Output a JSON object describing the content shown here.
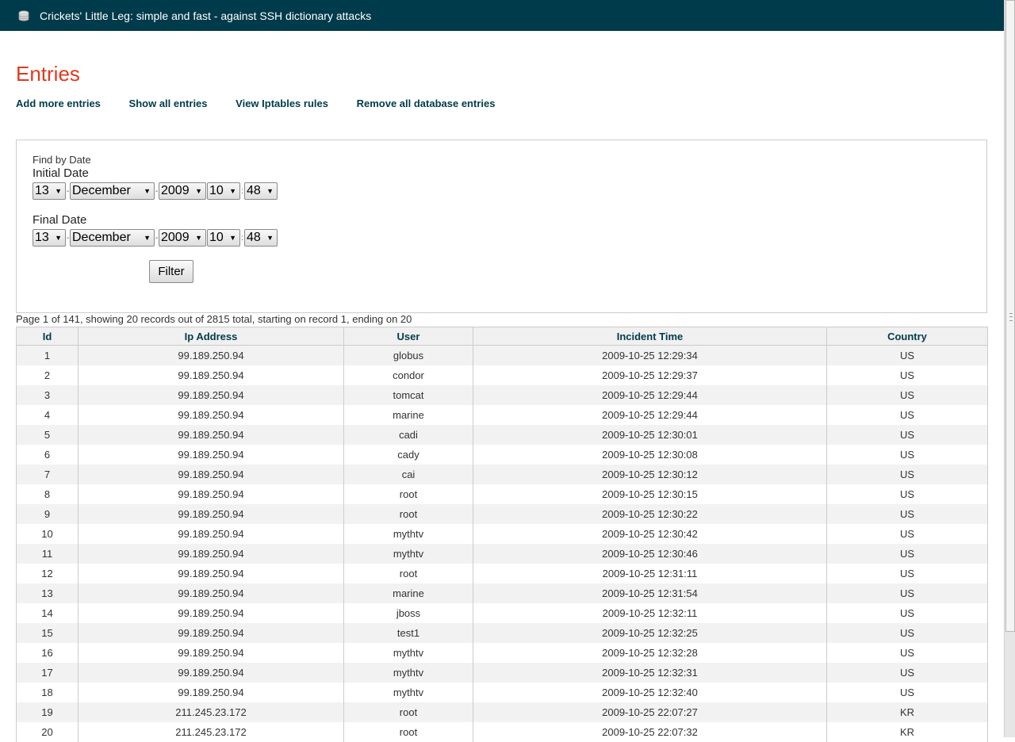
{
  "window": {
    "title": "Crickets' Little Leg: simple and fast - against SSH dictionary attacks"
  },
  "page": {
    "heading": "Entries"
  },
  "nav": [
    {
      "label": "Add more entries"
    },
    {
      "label": "Show all entries"
    },
    {
      "label": "View Iptables rules"
    },
    {
      "label": "Remove all database entries"
    }
  ],
  "filter": {
    "legend": "Find by Date",
    "initial": {
      "label": "Initial Date",
      "day": "13",
      "month": "December",
      "year": "2009",
      "hour": "10",
      "minute": "48"
    },
    "final": {
      "label": "Final Date",
      "day": "13",
      "month": "December",
      "year": "2009",
      "hour": "10",
      "minute": "48"
    },
    "date_sep": "-",
    "time_sep": ":",
    "button": "Filter"
  },
  "pagination": {
    "text": "Page 1 of 141, showing 20 records out of 2815 total, starting on record 1, ending on 20"
  },
  "table": {
    "columns": [
      "Id",
      "Ip Address",
      "User",
      "Incident Time",
      "Country"
    ],
    "rows": [
      [
        "1",
        "99.189.250.94",
        "globus",
        "2009-10-25 12:29:34",
        "US"
      ],
      [
        "2",
        "99.189.250.94",
        "condor",
        "2009-10-25 12:29:37",
        "US"
      ],
      [
        "3",
        "99.189.250.94",
        "tomcat",
        "2009-10-25 12:29:44",
        "US"
      ],
      [
        "4",
        "99.189.250.94",
        "marine",
        "2009-10-25 12:29:44",
        "US"
      ],
      [
        "5",
        "99.189.250.94",
        "cadi",
        "2009-10-25 12:30:01",
        "US"
      ],
      [
        "6",
        "99.189.250.94",
        "cady",
        "2009-10-25 12:30:08",
        "US"
      ],
      [
        "7",
        "99.189.250.94",
        "cai",
        "2009-10-25 12:30:12",
        "US"
      ],
      [
        "8",
        "99.189.250.94",
        "root",
        "2009-10-25 12:30:15",
        "US"
      ],
      [
        "9",
        "99.189.250.94",
        "root",
        "2009-10-25 12:30:22",
        "US"
      ],
      [
        "10",
        "99.189.250.94",
        "mythtv",
        "2009-10-25 12:30:42",
        "US"
      ],
      [
        "11",
        "99.189.250.94",
        "mythtv",
        "2009-10-25 12:30:46",
        "US"
      ],
      [
        "12",
        "99.189.250.94",
        "root",
        "2009-10-25 12:31:11",
        "US"
      ],
      [
        "13",
        "99.189.250.94",
        "marine",
        "2009-10-25 12:31:54",
        "US"
      ],
      [
        "14",
        "99.189.250.94",
        "jboss",
        "2009-10-25 12:32:11",
        "US"
      ],
      [
        "15",
        "99.189.250.94",
        "test1",
        "2009-10-25 12:32:25",
        "US"
      ],
      [
        "16",
        "99.189.250.94",
        "mythtv",
        "2009-10-25 12:32:28",
        "US"
      ],
      [
        "17",
        "99.189.250.94",
        "mythtv",
        "2009-10-25 12:32:31",
        "US"
      ],
      [
        "18",
        "99.189.250.94",
        "mythtv",
        "2009-10-25 12:32:40",
        "US"
      ],
      [
        "19",
        "211.245.23.172",
        "root",
        "2009-10-25 22:07:27",
        "KR"
      ],
      [
        "20",
        "211.245.23.172",
        "root",
        "2009-10-25 22:07:32",
        "KR"
      ]
    ]
  },
  "colors": {
    "titlebar": "#003b4b",
    "heading": "#e03a1e",
    "link": "#003b4b",
    "row_alt": "#f2f2f2"
  },
  "icons": {
    "app": "database-icon",
    "dropdown": "triangle-down"
  }
}
